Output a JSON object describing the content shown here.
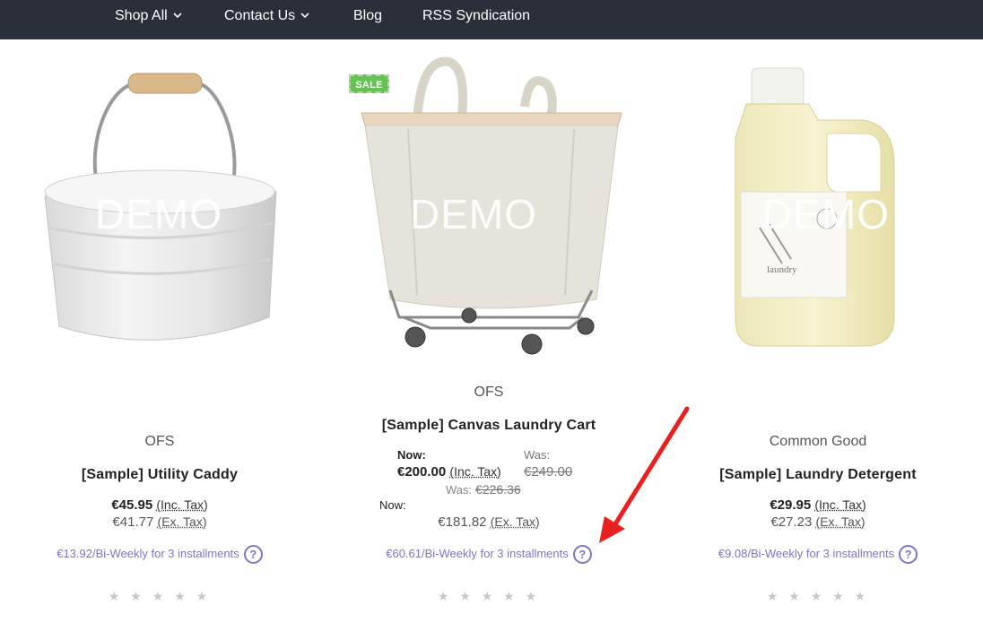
{
  "nav": {
    "items": [
      {
        "label": "Shop All",
        "dropdown": true
      },
      {
        "label": "Contact Us",
        "dropdown": true
      },
      {
        "label": "Blog",
        "dropdown": false
      },
      {
        "label": "RSS Syndication",
        "dropdown": false
      }
    ]
  },
  "products": [
    {
      "image_watermark": "DEMO",
      "brand": "OFS",
      "name": "[Sample] Utility Caddy",
      "price_inc": "€45.95",
      "price_inc_label": "(Inc. Tax)",
      "price_ex": "€41.77",
      "price_ex_label": "(Ex. Tax)",
      "installments": "€13.92/Bi-Weekly for 3 installments",
      "help_icon": "question-circle-icon",
      "rating": "★ ★ ★ ★ ★"
    },
    {
      "image_watermark": "DEMO",
      "badge": "SALE",
      "brand": "OFS",
      "name": "[Sample] Canvas Laundry Cart",
      "now_label": "Now:",
      "price_inc": "€200.00",
      "price_inc_label": "(Inc. Tax)",
      "was_label": "Was:",
      "was_inc": "€249.00",
      "was_ex_label": "Was:",
      "was_ex": "€226.36",
      "now_ex_label": "Now:",
      "price_ex": "€181.82",
      "price_ex_label": "(Ex. Tax)",
      "installments": "€60.61/Bi-Weekly for 3 installments",
      "help_icon": "question-circle-icon",
      "rating": "★ ★ ★ ★ ★"
    },
    {
      "image_watermark": "DEMO",
      "brand": "Common Good",
      "name": "[Sample] Laundry Detergent",
      "price_inc": "€29.95",
      "price_inc_label": "(Inc. Tax)",
      "price_ex": "€27.23",
      "price_ex_label": "(Ex. Tax)",
      "installments": "€9.08/Bi-Weekly for 3 installments",
      "help_icon": "question-circle-icon",
      "rating": "★ ★ ★ ★ ★",
      "label_text": "laundry"
    }
  ],
  "colors": {
    "nav_bg": "#2b2f3a",
    "installment": "#7b76c9",
    "sale": "#67c255",
    "arrow": "#e8201f"
  }
}
